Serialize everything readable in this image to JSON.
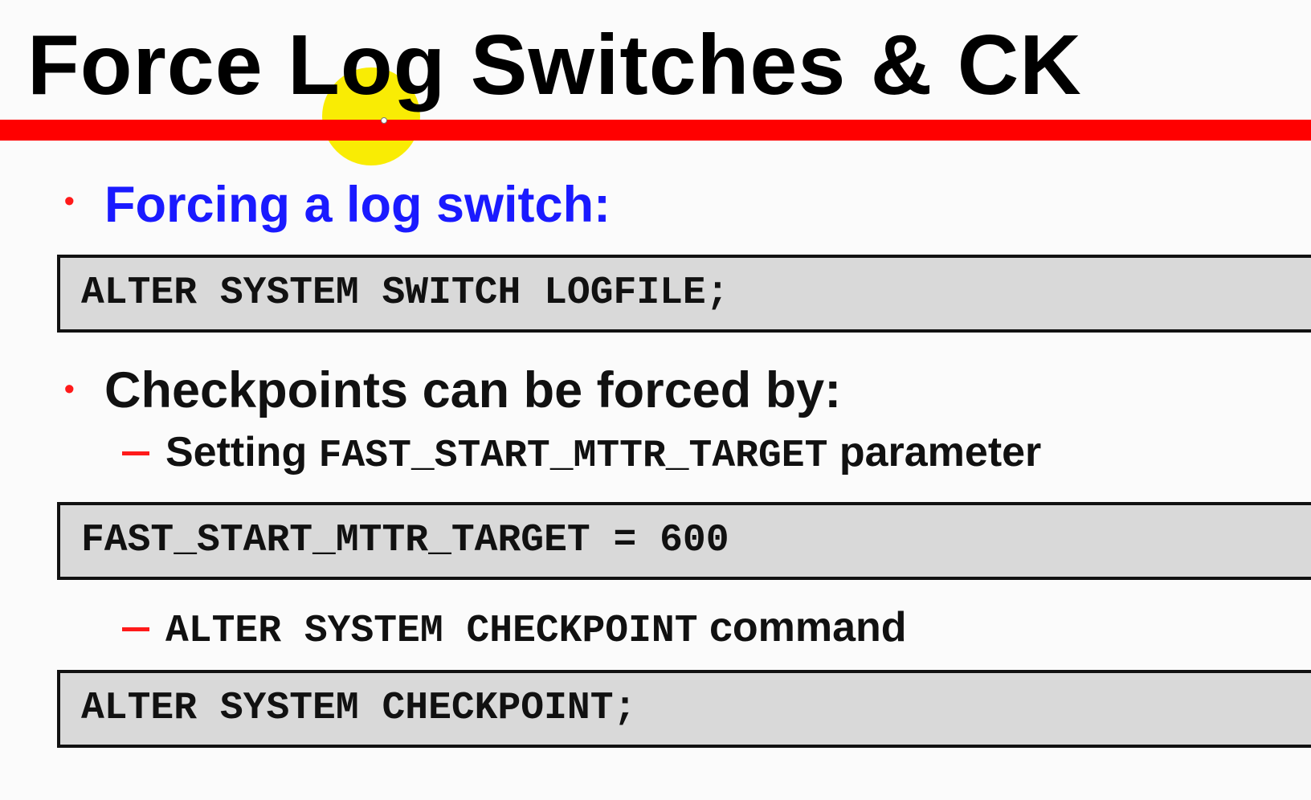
{
  "slide": {
    "title": "Force Log Switches & CK",
    "bullets": [
      {
        "text": "Forcing a log switch:",
        "code": "ALTER SYSTEM SWITCH LOGFILE;"
      },
      {
        "text": "Checkpoints can be forced by:",
        "subitems": [
          {
            "prefix": "Setting ",
            "code_inline": "FAST_START_MTTR_TARGET",
            "suffix": " parameter",
            "code": "FAST_START_MTTR_TARGET = 600"
          },
          {
            "prefix": "",
            "code_inline": "ALTER SYSTEM CHECKPOINT",
            "suffix": " command",
            "code": "ALTER SYSTEM CHECKPOINT;"
          }
        ]
      }
    ]
  },
  "colors": {
    "title_rule": "#ff0000",
    "bullet_1_text": "#1a1aff",
    "bullet_marker": "#ff1a1a",
    "code_background": "#d9d9d9",
    "cursor_highlight": "#f9ec04"
  }
}
